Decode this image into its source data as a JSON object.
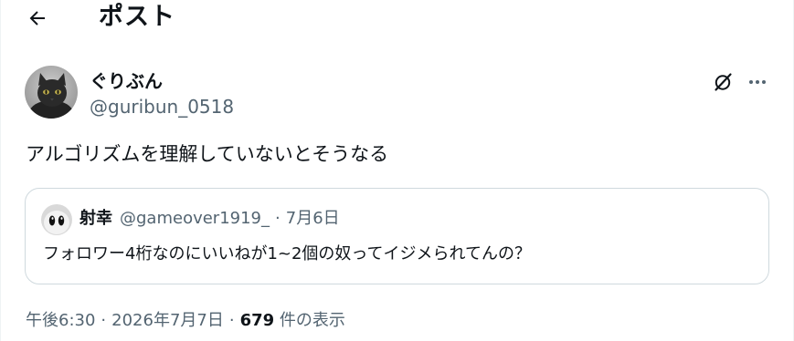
{
  "header": {
    "back_icon": "arrow-left-icon",
    "title": "ポスト"
  },
  "post": {
    "author_name": "ぐりぶん",
    "author_handle": "@guribun_0518",
    "avatar": "black-cat-photo",
    "grok_icon": "grok-icon",
    "more_icon": "more-horizontal-icon",
    "text": "アルゴリズムを理解していないとそうなる",
    "quote": {
      "name": "射幸",
      "handle": "@gameover1919_",
      "separator": "·",
      "date": "7月6日",
      "text": "フォロワー4桁なのにいいねが1~2個の奴ってイジメられてんの？"
    },
    "meta": {
      "time": "午後6:30",
      "sep1": "·",
      "date": "2026年7月7日",
      "sep2": "·",
      "views_count": "679",
      "views_label": "件の表示"
    }
  },
  "colors": {
    "text_primary": "#0f1419",
    "text_secondary": "#536471",
    "border": "#cfd9de"
  }
}
